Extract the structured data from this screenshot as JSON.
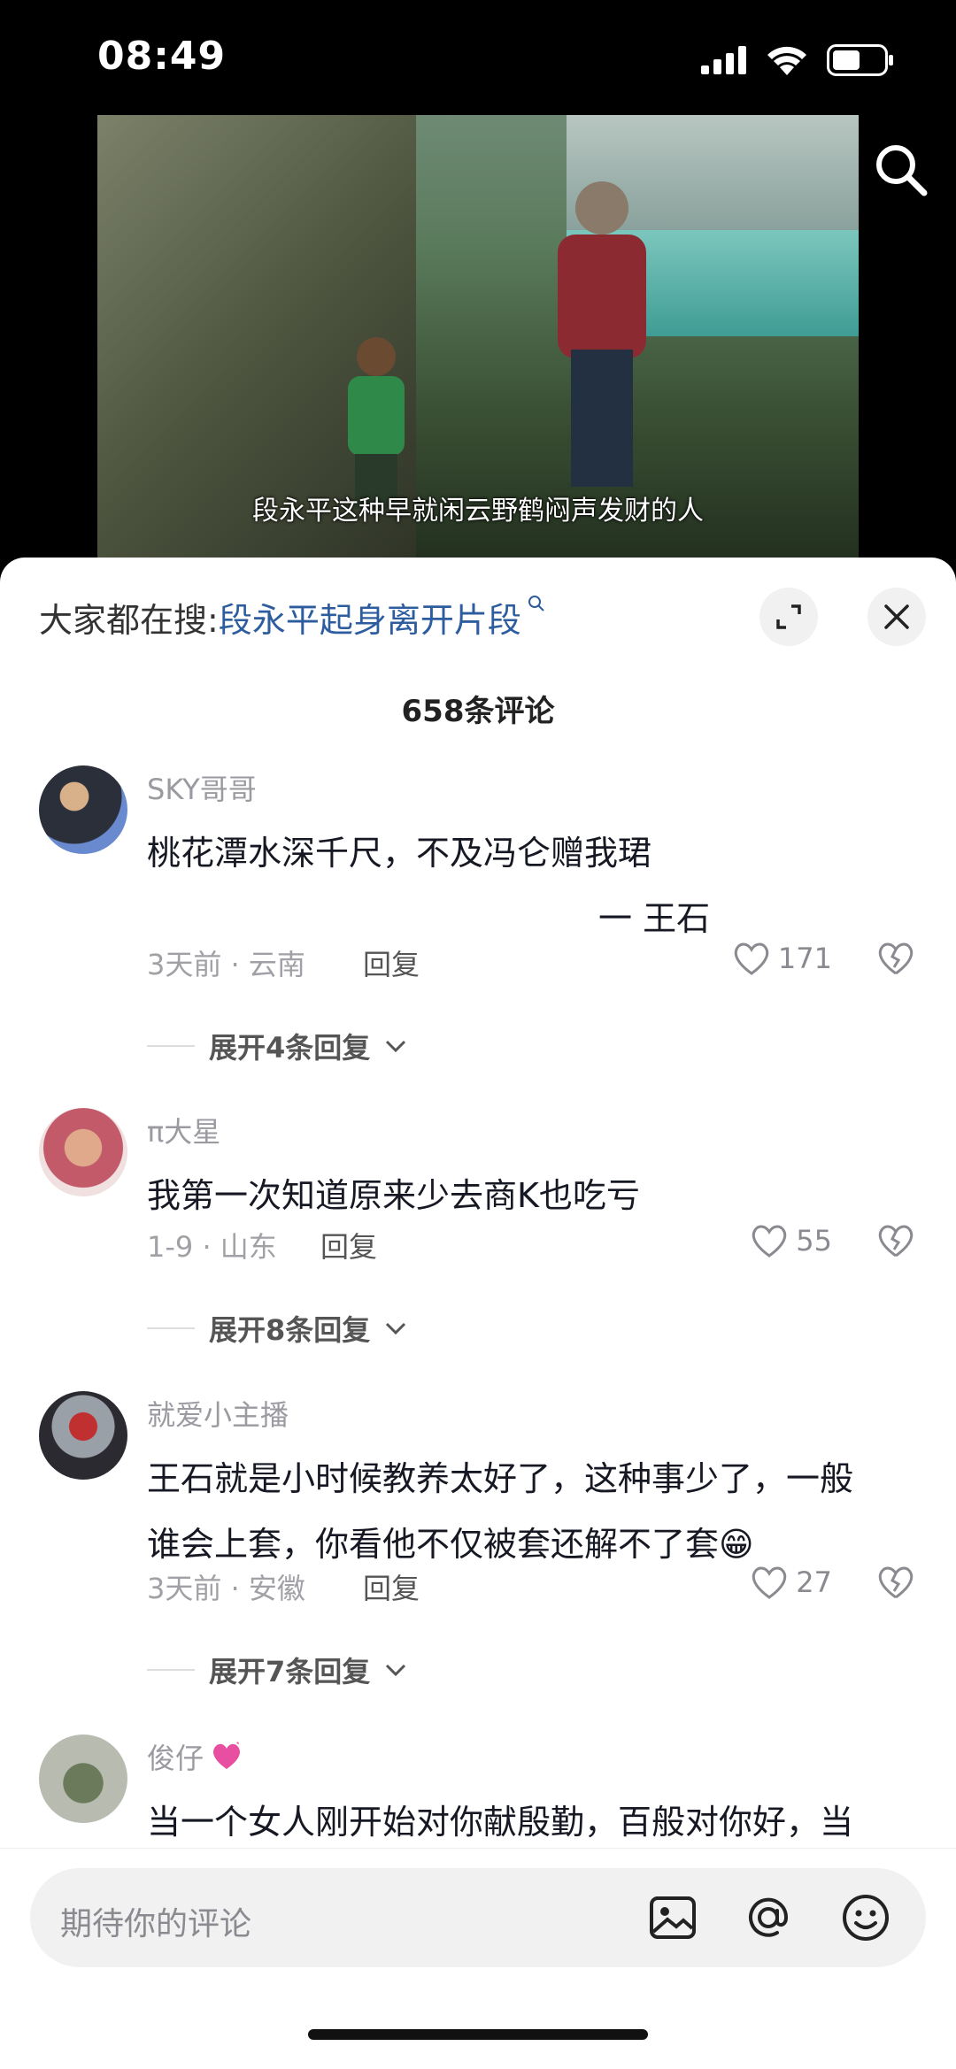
{
  "status": {
    "time": "08:49"
  },
  "video": {
    "subtitle": "段永平这种早就闲云野鹤闷声发财的人"
  },
  "sheet": {
    "hot_prefix": "大家都在搜:",
    "hot_keyword": "段永平起身离开片段",
    "comment_count": "658条评论"
  },
  "comments": [
    {
      "user": "SKY哥哥",
      "text1": "桃花潭水深千尺，不及冯仑赠我珺",
      "text2": "一 王石",
      "meta": "3天前 · 云南",
      "reply": "回复",
      "likes": "171",
      "expand": "展开4条回复"
    },
    {
      "user": "π大星",
      "text1": "我第一次知道原来少去商K也吃亏",
      "meta": "1-9 · 山东",
      "reply": "回复",
      "likes": "55",
      "expand": "展开8条回复"
    },
    {
      "user": "就爱小主播",
      "text1": "王石就是小时候教养太好了，这种事少了，一般",
      "text2": "谁会上套，你看他不仅被套还解不了套😁",
      "meta": "3天前 · 安徽",
      "reply": "回复",
      "likes": "27",
      "expand": "展开7条回复"
    },
    {
      "user": "俊仔",
      "text1": "当一个女人刚开始对你献殷勤，百般对你好，当"
    }
  ],
  "input": {
    "placeholder": "期待你的评论"
  },
  "icons": [
    "search-icon",
    "expand-icon",
    "close-icon",
    "heart-icon",
    "broken-heart-icon",
    "chevron-down-icon",
    "image-icon",
    "at-icon",
    "emoji-icon",
    "signal-icon",
    "wifi-icon",
    "battery-icon",
    "sparkling-heart-icon"
  ]
}
